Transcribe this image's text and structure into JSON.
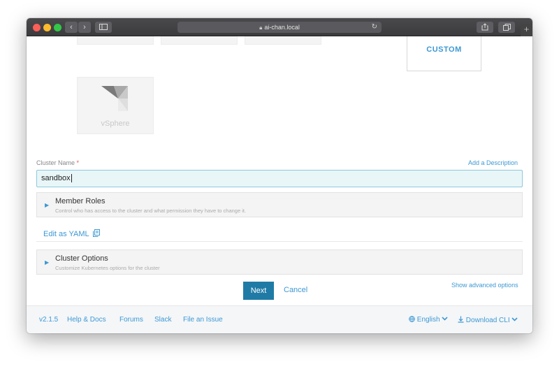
{
  "browser": {
    "url": "ai-chan.local",
    "lock_icon": "lock-icon",
    "back_icon": "chevron-left-icon",
    "forward_icon": "chevron-right-icon"
  },
  "custom_tile": {
    "label": "CUSTOM"
  },
  "vsphere_tile": {
    "label": "vSphere"
  },
  "cluster_name": {
    "label": "Cluster Name",
    "required_mark": "*",
    "value": "sandbox",
    "add_description_link": "Add a Description"
  },
  "member_roles": {
    "title": "Member Roles",
    "description": "Control who has access to the cluster and what permission they have to change it."
  },
  "edit_yaml": {
    "label": "Edit as YAML"
  },
  "cluster_options": {
    "title": "Cluster Options",
    "description": "Customize Kubernetes options for the cluster"
  },
  "show_advanced_link": "Show advanced options",
  "actions": {
    "next_label": "Next",
    "cancel_label": "Cancel"
  },
  "footer": {
    "version": "v2.1.5",
    "help_docs": "Help & Docs",
    "forums": "Forums",
    "slack": "Slack",
    "file_issue": "File an Issue",
    "language": "English",
    "download_cli": "Download CLI"
  },
  "colors": {
    "accent": "#3d98d3",
    "primary_button": "#1f7ba6",
    "required": "#e25a4a"
  }
}
